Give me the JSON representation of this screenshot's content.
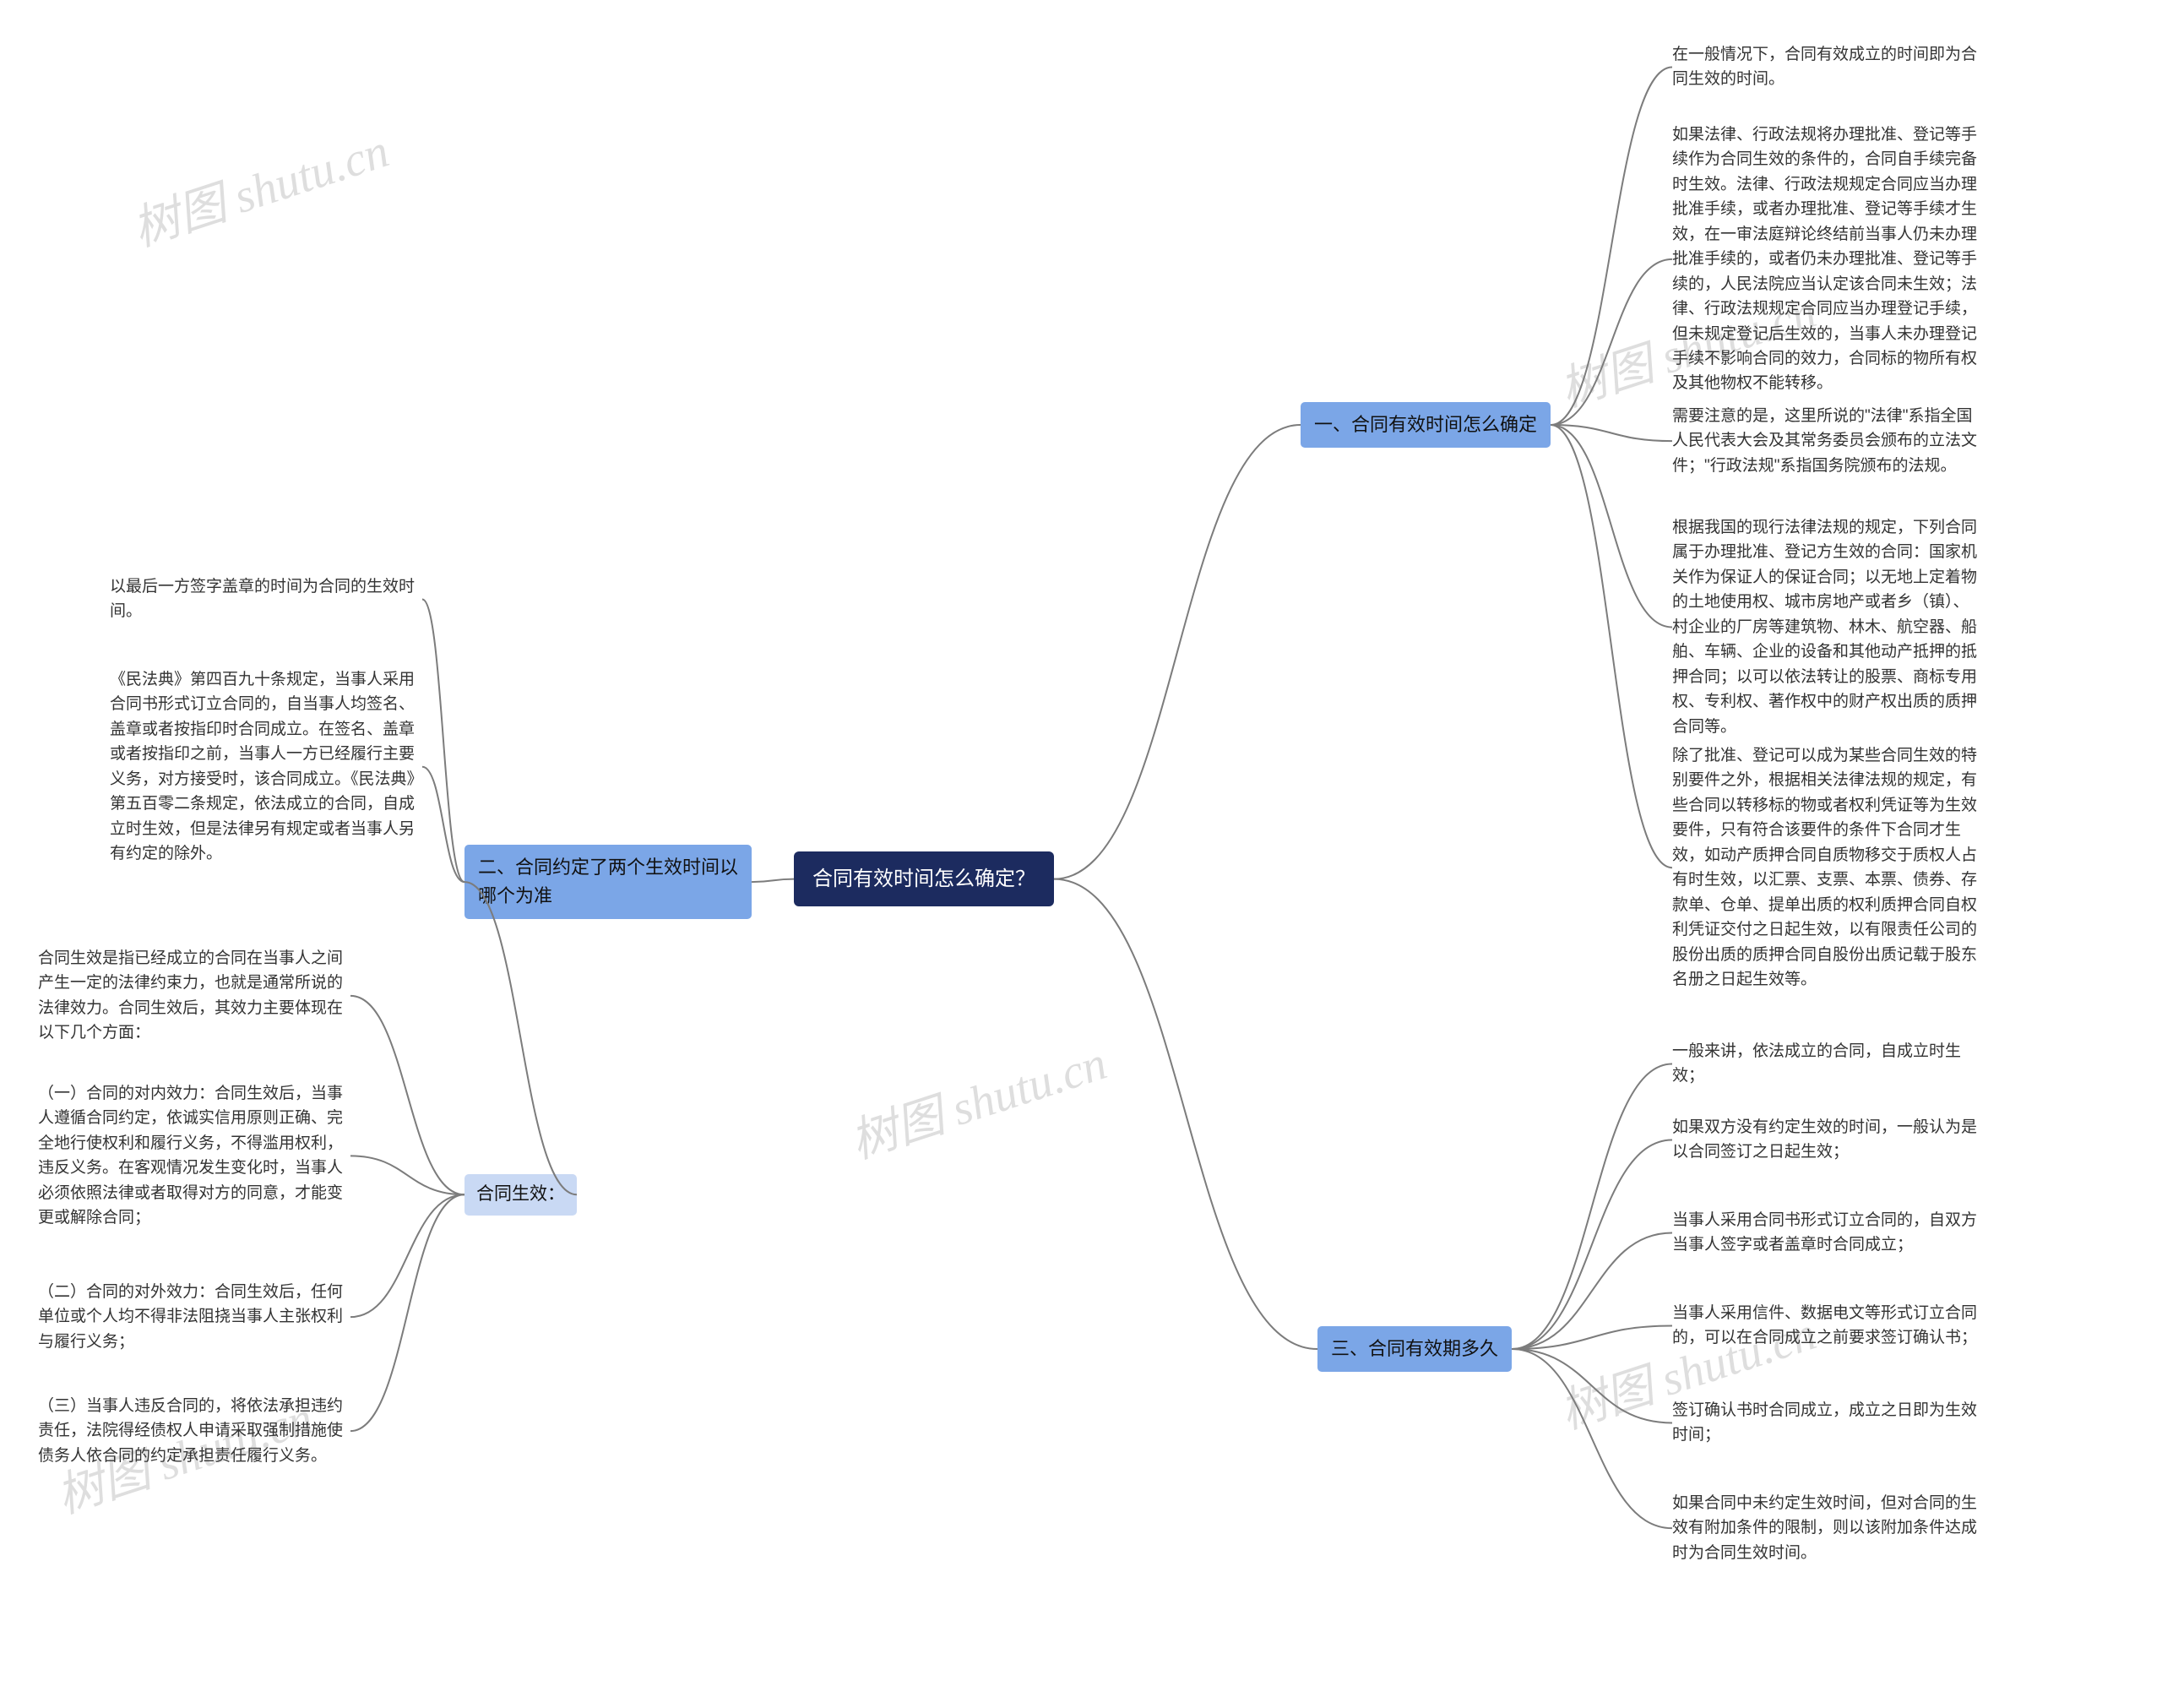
{
  "root": {
    "title": "合同有效时间怎么确定？"
  },
  "right": {
    "b1": {
      "label": "一、合同有效时间怎么确定",
      "leaves": [
        "在一般情况下，合同有效成立的时间即为合同生效的时间。",
        "如果法律、行政法规将办理批准、登记等手续作为合同生效的条件的，合同自手续完备时生效。法律、行政法规规定合同应当办理批准手续，或者办理批准、登记等手续才生效，在一审法庭辩论终结前当事人仍未办理批准手续的，或者仍未办理批准、登记等手续的，人民法院应当认定该合同未生效；法律、行政法规规定合同应当办理登记手续，但未规定登记后生效的，当事人未办理登记手续不影响合同的效力，合同标的物所有权及其他物权不能转移。",
        "需要注意的是，这里所说的\"法律\"系指全国人民代表大会及其常务委员会颁布的立法文件；\"行政法规\"系指国务院颁布的法规。",
        "根据我国的现行法律法规的规定，下列合同属于办理批准、登记方生效的合同：国家机关作为保证人的保证合同；以无地上定着物的土地使用权、城市房地产或者乡（镇）、村企业的厂房等建筑物、林木、航空器、船舶、车辆、企业的设备和其他动产抵押的抵押合同；以可以依法转让的股票、商标专用权、专利权、著作权中的财产权出质的质押合同等。",
        "除了批准、登记可以成为某些合同生效的特别要件之外，根据相关法律法规的规定，有些合同以转移标的物或者权利凭证等为生效要件，只有符合该要件的条件下合同才生效，如动产质押合同自质物移交于质权人占有时生效，以汇票、支票、本票、债券、存款单、仓单、提单出质的权利质押合同自权利凭证交付之日起生效，以有限责任公司的股份出质的质押合同自股份出质记载于股东名册之日起生效等。"
      ]
    },
    "b3": {
      "label": "三、合同有效期多久",
      "leaves": [
        "一般来讲，依法成立的合同，自成立时生效；",
        "如果双方没有约定生效的时间，一般认为是以合同签订之日起生效；",
        "当事人采用合同书形式订立合同的，自双方当事人签字或者盖章时合同成立；",
        "当事人采用信件、数据电文等形式订立合同的，可以在合同成立之前要求签订确认书；",
        "签订确认书时合同成立，成立之日即为生效时间；",
        "如果合同中未约定生效时间，但对合同的生效有附加条件的限制，则以该附加条件达成时为合同生效时间。"
      ]
    }
  },
  "left": {
    "b2": {
      "label": "二、合同约定了两个生效时间以哪个为准",
      "leaves": [
        "以最后一方签字盖章的时间为合同的生效时间。",
        "《民法典》第四百九十条规定，当事人采用合同书形式订立合同的，自当事人均签名、盖章或者按指印时合同成立。在签名、盖章或者按指印之前，当事人一方已经履行主要义务，对方接受时，该合同成立。《民法典》第五百零二条规定，依法成立的合同，自成立时生效，但是法律另有规定或者当事人另有约定的除外。"
      ],
      "sub": {
        "label": "合同生效：",
        "leaves": [
          "合同生效是指已经成立的合同在当事人之间产生一定的法律约束力，也就是通常所说的法律效力。合同生效后，其效力主要体现在以下几个方面：",
          "（一）合同的对内效力：合同生效后，当事人遵循合同约定，依诚实信用原则正确、完全地行使权利和履行义务，不得滥用权利，违反义务。在客观情况发生变化时，当事人必须依照法律或者取得对方的同意，才能变更或解除合同；",
          "（二）合同的对外效力：合同生效后，任何单位或个人均不得非法阻挠当事人主张权利与履行义务；",
          "（三）当事人违反合同的，将依法承担违约责任，法院得经债权人申请采取强制措施使债务人依合同的约定承担责任履行义务。"
        ]
      }
    }
  },
  "watermark": "树图 shutu.cn"
}
